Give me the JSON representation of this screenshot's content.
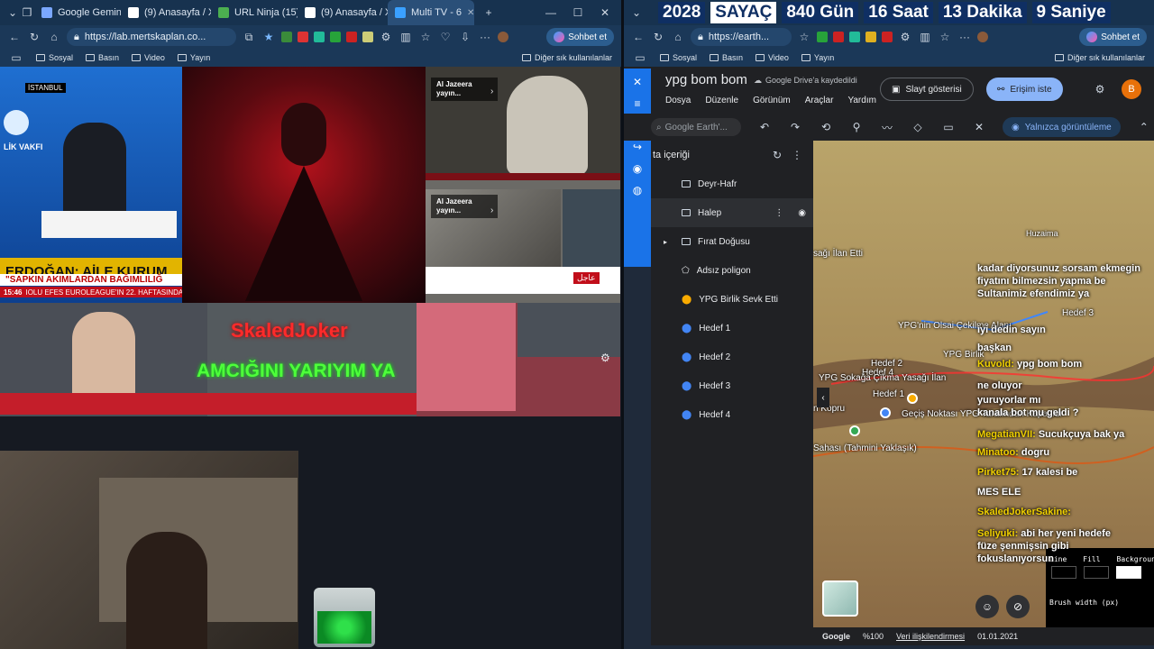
{
  "left_window": {
    "tabs": [
      {
        "label": "",
        "color": "#4a6a8a"
      },
      {
        "label": "Google Gemini",
        "color": "#7aa7ff"
      },
      {
        "label": "(9) Anasayfa / X",
        "color": "#ffffff"
      },
      {
        "label": "URL Ninja (15)",
        "color": "#4caf50"
      },
      {
        "label": "(9) Anasayfa / X",
        "color": "#ffffff"
      },
      {
        "label": "Multi TV - 6",
        "color": "#3aa0ff"
      }
    ],
    "url": "https://lab.mertskaplan.co...",
    "chat_label": "Sohbet et",
    "bookmarks": [
      "Sosyal",
      "Basın",
      "Video",
      "Yayın"
    ],
    "bookmarks_other": "Diğer sık kullanılanlar",
    "panels": {
      "istanbul_tag": "İSTANBUL",
      "vakfi": "LİK VAKFI",
      "breaking_headline": "ERDOĞAN: AİLE KURUM",
      "breaking_sub": "\"SAPKIN AKIMLARDAN BAĞIMLILIĞ",
      "ticker_time": "15:46",
      "ticker_text": "IOLU EFES EUROLEAGUE'IN 22. HAFTASINDA",
      "aj_label_1": "Al Jazeera yayın...",
      "aj_label_2": "Al Jazeera yayın...",
      "aj_flag": "عاجل",
      "overlay_name": "SkaledJoker",
      "overlay_text": "AMCIĞINI YARIYIM YA"
    }
  },
  "right_window": {
    "countdown": {
      "year": "2028",
      "label": "SAYAÇ",
      "days": "840 Gün",
      "hours": "16 Saat",
      "minutes": "13 Dakika",
      "seconds": "9 Saniye"
    },
    "url": "https://earth...",
    "chat_label": "Sohbet et",
    "bookmarks": [
      "Sosyal",
      "Basın",
      "Video",
      "Yayın"
    ],
    "bookmarks_other": "Diğer sık kullanılanlar",
    "earth": {
      "project_title": "ypg bom bom",
      "saved": "Google Drive'a kaydedildi",
      "slideshow": "Slayt gösterisi",
      "request_access": "Erişim iste",
      "avatar": "B",
      "menu": [
        "Dosya",
        "Düzenle",
        "Görünüm",
        "Araçlar",
        "Yardım"
      ],
      "search_placeholder": "Google Earth'...",
      "view_only": "Yalnızca görüntüleme",
      "panel_title": "ta içeriği",
      "items": [
        {
          "label": "Deyr-Hafr",
          "icon": "folder"
        },
        {
          "label": "Halep",
          "icon": "folder"
        },
        {
          "label": "Fırat Doğusu",
          "icon": "folder"
        },
        {
          "label": "Adsız poligon",
          "icon": "polygon"
        },
        {
          "label": "YPG Birlik Sevk Etti",
          "icon": "pin-yellow"
        },
        {
          "label": "Hedef 1",
          "icon": "pin-blue"
        },
        {
          "label": "Hedef 2",
          "icon": "pin-blue"
        },
        {
          "label": "Hedef 3",
          "icon": "pin-blue"
        },
        {
          "label": "Hedef 4",
          "icon": "pin-blue"
        }
      ],
      "map_labels": [
        "sağı İlan Etti",
        "Huzaima",
        "YPG'nin Olsai Çekilme Alanı",
        "Hedef 3",
        "Hedef 2",
        "Hedef 4",
        "Hedef 1",
        "YPG Sokağa Çıkma Yasağı İlan",
        "YPG Birlik",
        "n Kopru",
        "Geçiş Noktası YPG Tarafından Kapatıldı",
        "Sahası (Tahmini Yaklaşık)"
      ],
      "footer": {
        "brand": "Google",
        "zoom": "%100",
        "data_link": "Veri ilişkilendirmesi",
        "date": "01.01.2021"
      },
      "paint": {
        "line": "Line",
        "fill": "Fill",
        "background": "Background",
        "brush": "Brush width (px)"
      }
    },
    "chat": [
      {
        "user": "",
        "msg": "kadar diyorsunuz sorsam ekmegin"
      },
      {
        "user": "",
        "msg": "fiyatını bilmezsin yapma be"
      },
      {
        "user": "",
        "msg": "Sultanimiz efendimiz ya"
      },
      {
        "user": "",
        "msg": ""
      },
      {
        "user": "",
        "msg": "iyi dedin sayın"
      },
      {
        "user": "",
        "msg": "başkan"
      },
      {
        "user": "Kuvold:",
        "msg": "ypg bom bom"
      },
      {
        "user": "",
        "msg": "ne oluyor"
      },
      {
        "user": "",
        "msg": "yuruyorlar mı"
      },
      {
        "user": "",
        "msg": "kanala bot mu geldi ?"
      },
      {
        "user": "MegatianVII:",
        "msg": "Sucukçuya bak ya"
      },
      {
        "user": "Minatoo:",
        "msg": "dogru"
      },
      {
        "user": "Pirket75:",
        "msg": "17 kalesi be"
      },
      {
        "user": "",
        "msg": "MES ELE"
      },
      {
        "user": "SkaledJokerSakine:",
        "msg": ""
      },
      {
        "user": "Seliyuki:",
        "msg": "abi her yeni hedefe"
      },
      {
        "user": "",
        "msg": "füze şenmişsin gibi"
      },
      {
        "user": "",
        "msg": "fokuslanıyorsun"
      }
    ]
  }
}
